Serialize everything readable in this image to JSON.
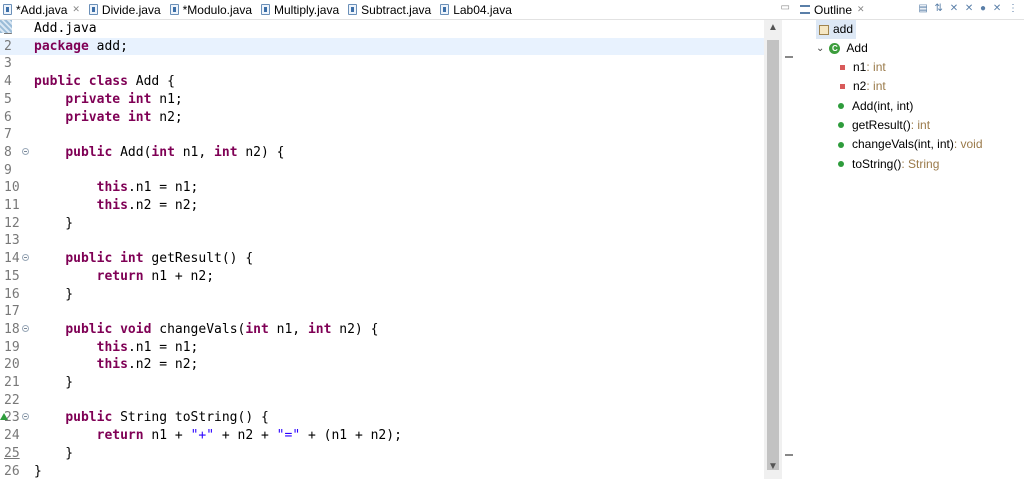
{
  "tabs": [
    {
      "label": "*Add.java",
      "active": true,
      "close": true
    },
    {
      "label": "Divide.java"
    },
    {
      "label": "*Modulo.java"
    },
    {
      "label": "Multiply.java"
    },
    {
      "label": "Subtract.java"
    },
    {
      "label": "Lab04.java"
    }
  ],
  "code": {
    "lines": [
      {
        "n": "1",
        "t": "Add.java"
      },
      {
        "n": "2",
        "t": "package add;"
      },
      {
        "n": "3",
        "t": ""
      },
      {
        "n": "4",
        "t": "public class Add {"
      },
      {
        "n": "5",
        "t": "    private int n1;"
      },
      {
        "n": "6",
        "t": "    private int n2;"
      },
      {
        "n": "7",
        "t": ""
      },
      {
        "n": "8",
        "t": "    public Add(int n1, int n2) {"
      },
      {
        "n": "9",
        "t": ""
      },
      {
        "n": "10",
        "t": "        this.n1 = n1;"
      },
      {
        "n": "11",
        "t": "        this.n2 = n2;"
      },
      {
        "n": "12",
        "t": "    }"
      },
      {
        "n": "13",
        "t": ""
      },
      {
        "n": "14",
        "t": "    public int getResult() {"
      },
      {
        "n": "15",
        "t": "        return n1 + n2;"
      },
      {
        "n": "16",
        "t": "    }"
      },
      {
        "n": "17",
        "t": ""
      },
      {
        "n": "18",
        "t": "    public void changeVals(int n1, int n2) {"
      },
      {
        "n": "19",
        "t": "        this.n1 = n1;"
      },
      {
        "n": "20",
        "t": "        this.n2 = n2;"
      },
      {
        "n": "21",
        "t": "    }"
      },
      {
        "n": "22",
        "t": ""
      },
      {
        "n": "23",
        "t": "    public String toString() {"
      },
      {
        "n": "24",
        "t": "        return n1 + \"+\" + n2 + \"=\" + (n1 + n2);"
      },
      {
        "n": "25",
        "t": "    }"
      },
      {
        "n": "26",
        "t": "}"
      }
    ]
  },
  "outline": {
    "title": "Outline",
    "package": "add",
    "class": "Add",
    "members": [
      {
        "name": "n1",
        "type": " : int",
        "kind": "field"
      },
      {
        "name": "n2",
        "type": " : int",
        "kind": "field"
      },
      {
        "name": "Add(int, int)",
        "type": "",
        "kind": "ctor"
      },
      {
        "name": "getResult()",
        "type": " : int",
        "kind": "method"
      },
      {
        "name": "changeVals(int, int)",
        "type": " : void",
        "kind": "method"
      },
      {
        "name": "toString()",
        "type": " : String",
        "kind": "method"
      }
    ]
  }
}
